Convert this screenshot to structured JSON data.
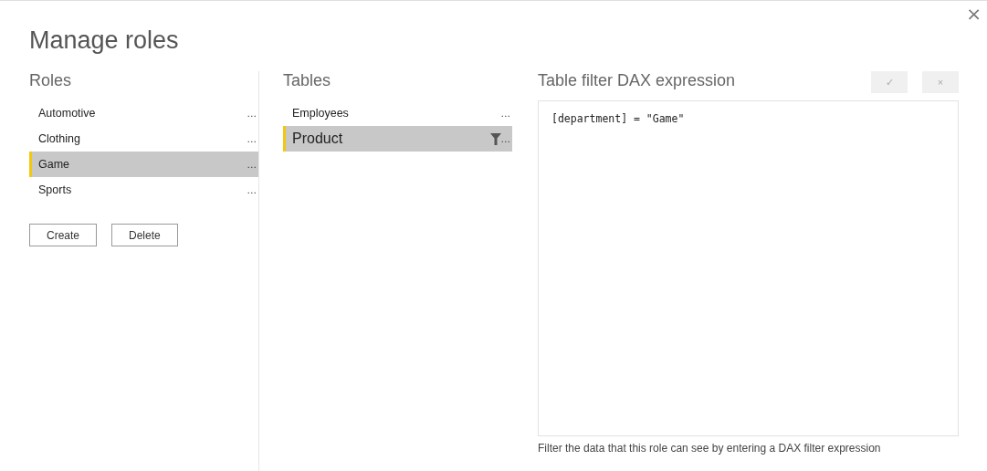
{
  "dialog": {
    "title": "Manage roles",
    "close": "×"
  },
  "roles": {
    "heading": "Roles",
    "items": [
      {
        "name": "Automotive",
        "more": "...",
        "selected": false
      },
      {
        "name": "Clothing",
        "more": "...",
        "selected": false
      },
      {
        "name": "Game",
        "more": "...",
        "selected": true
      },
      {
        "name": "Sports",
        "more": "...",
        "selected": false
      }
    ],
    "buttons": [
      "Create",
      "Delete"
    ]
  },
  "tables": {
    "heading": "Tables",
    "items": [
      {
        "name": "Employees",
        "more": "...",
        "selected": false,
        "filtered": false
      },
      {
        "name": "Product",
        "more": "...",
        "selected": true,
        "filtered": true
      }
    ]
  },
  "expression": {
    "heading": "Table filter DAX expression",
    "confirm": {
      "label": "✓",
      "disabled": true
    },
    "cancel": {
      "label": "×",
      "disabled": true
    },
    "value": "[department] = \"Game\"",
    "hint": "Filter the data that this role can see by entering a DAX filter expression"
  }
}
